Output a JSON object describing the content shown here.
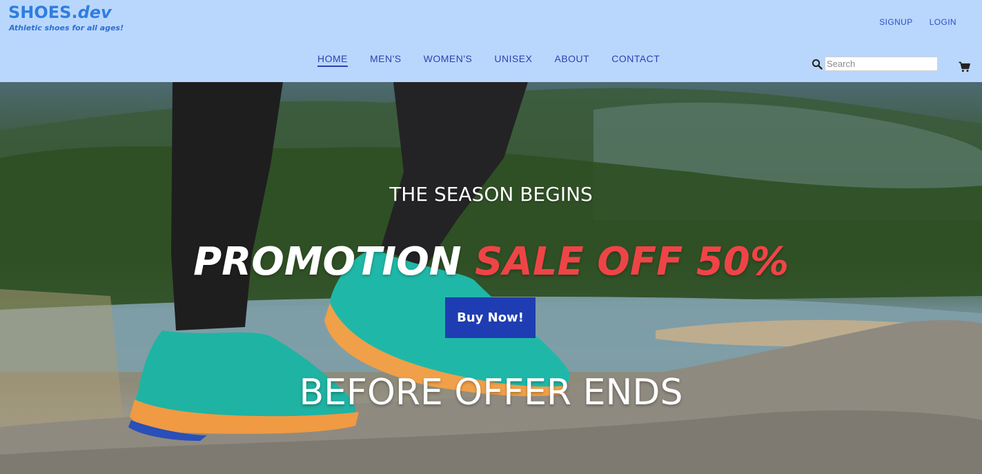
{
  "brand": {
    "name": "SHOES.",
    "name_suffix": "dev",
    "tagline": "Athletic shoes for all ages!"
  },
  "auth": {
    "signup": "SIGNUP",
    "login": "LOGIN"
  },
  "nav": {
    "items": [
      {
        "label": "HOME",
        "active": true
      },
      {
        "label": "MEN'S"
      },
      {
        "label": "WOMEN'S"
      },
      {
        "label": "UNISEX"
      },
      {
        "label": "ABOUT"
      },
      {
        "label": "CONTACT"
      }
    ]
  },
  "search": {
    "placeholder": "Search",
    "icon": "search-icon"
  },
  "cart": {
    "icon": "cart-icon"
  },
  "hero": {
    "kicker": "THE SEASON BEGINS",
    "headline_main": "PROMOTION ",
    "headline_highlight": "SALE OFF 50%",
    "cta": "Buy Now!",
    "footer": "BEFORE OFFER ENDS"
  },
  "colors": {
    "header_bg": "#b9d7fd",
    "brand": "#2f7de1",
    "nav_text": "#2e3fb4",
    "sale_red": "#ef4447",
    "button_bg": "#1f3db3"
  }
}
